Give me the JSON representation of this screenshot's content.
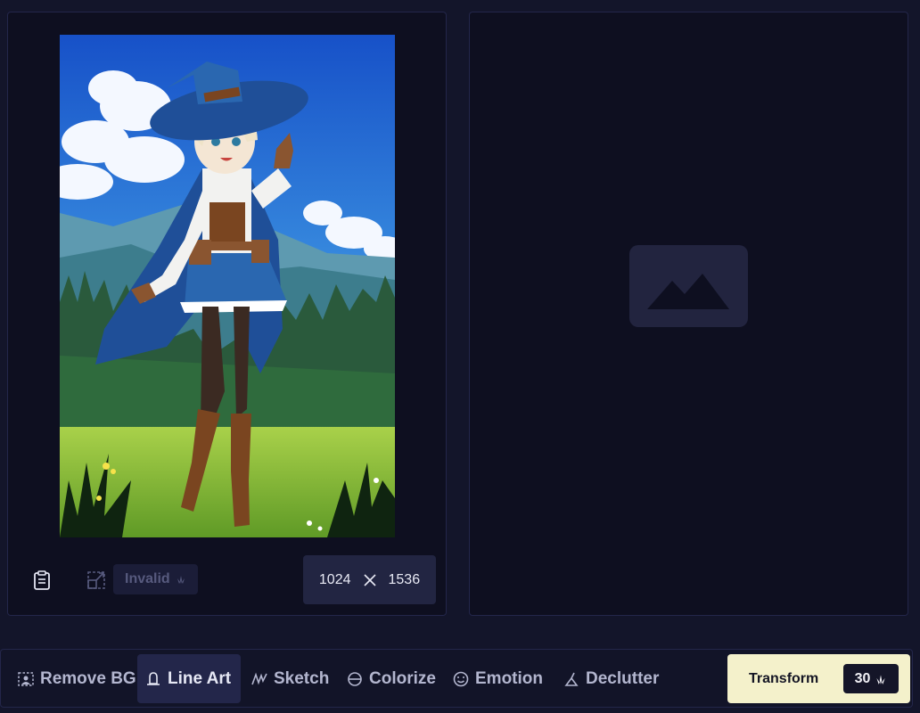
{
  "source_panel": {
    "image_description_name": "witch-character-illustration",
    "invalid_label": "Invalid",
    "dimensions": {
      "width": "1024",
      "height": "1536"
    }
  },
  "result_panel": {
    "placeholder_icon": "image-placeholder-icon"
  },
  "modes": [
    {
      "label": "Remove BG",
      "icon": "remove-bg-icon",
      "active": false
    },
    {
      "label": "Line Art",
      "icon": "bell-icon",
      "active": true
    },
    {
      "label": "Sketch",
      "icon": "sketch-icon",
      "active": false
    },
    {
      "label": "Colorize",
      "icon": "colorize-icon",
      "active": false
    },
    {
      "label": "Emotion",
      "icon": "emotion-icon",
      "active": false
    },
    {
      "label": "Declutter",
      "icon": "declutter-icon",
      "active": false
    }
  ],
  "transform": {
    "label": "Transform",
    "cost": "30",
    "cost_icon": "anlas-icon"
  },
  "colors": {
    "background": "#13152a",
    "panel": "#0e0f20",
    "accent_button": "#f4f1cb",
    "active_tab": "#23264a"
  }
}
